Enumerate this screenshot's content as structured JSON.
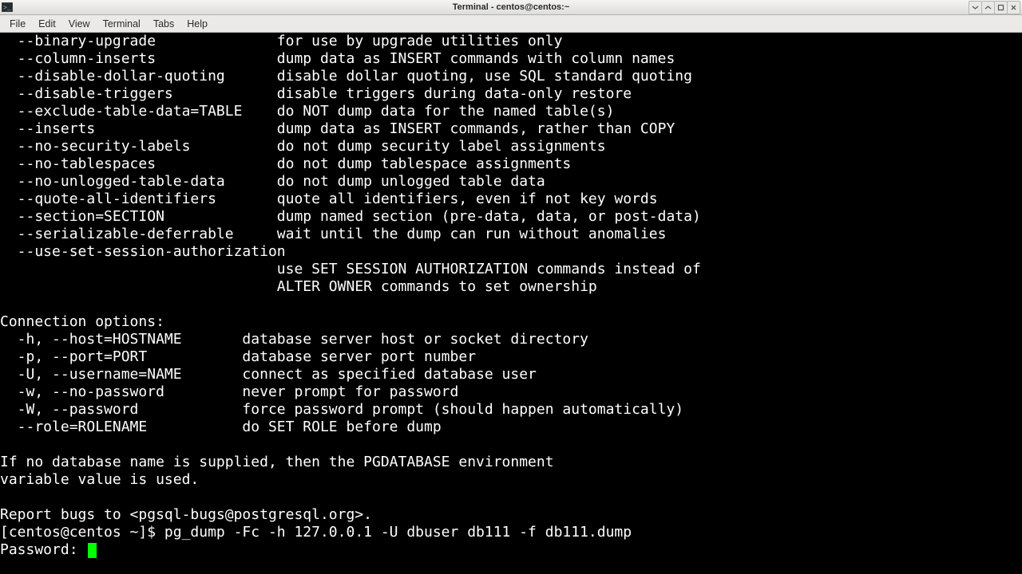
{
  "titlebar": {
    "title": "Terminal - centos@centos:~",
    "buttons": {
      "min": "▾",
      "max": "▴",
      "maxi": "▫",
      "close": "✕"
    }
  },
  "menubar": {
    "items": [
      "File",
      "Edit",
      "View",
      "Terminal",
      "Tabs",
      "Help"
    ]
  },
  "terminal": {
    "opts": [
      {
        "flag": "  --binary-upgrade",
        "desc": "for use by upgrade utilities only"
      },
      {
        "flag": "  --column-inserts",
        "desc": "dump data as INSERT commands with column names"
      },
      {
        "flag": "  --disable-dollar-quoting",
        "desc": "disable dollar quoting, use SQL standard quoting"
      },
      {
        "flag": "  --disable-triggers",
        "desc": "disable triggers during data-only restore"
      },
      {
        "flag": "  --exclude-table-data=TABLE",
        "desc": "do NOT dump data for the named table(s)"
      },
      {
        "flag": "  --inserts",
        "desc": "dump data as INSERT commands, rather than COPY"
      },
      {
        "flag": "  --no-security-labels",
        "desc": "do not dump security label assignments"
      },
      {
        "flag": "  --no-tablespaces",
        "desc": "do not dump tablespace assignments"
      },
      {
        "flag": "  --no-unlogged-table-data",
        "desc": "do not dump unlogged table data"
      },
      {
        "flag": "  --quote-all-identifiers",
        "desc": "quote all identifiers, even if not key words"
      },
      {
        "flag": "  --section=SECTION",
        "desc": "dump named section (pre-data, data, or post-data)"
      },
      {
        "flag": "  --serializable-deferrable",
        "desc": "wait until the dump can run without anomalies"
      }
    ],
    "auth_flag": "  --use-set-session-authorization",
    "auth_desc1": "                                   use SET SESSION AUTHORIZATION commands instead of",
    "auth_desc2": "                                   ALTER OWNER commands to set ownership",
    "blank": "",
    "conn_header": "Connection options:",
    "conn": [
      {
        "flag": "  -h, --host=HOSTNAME",
        "desc": "database server host or socket directory"
      },
      {
        "flag": "  -p, --port=PORT",
        "desc": "database server port number"
      },
      {
        "flag": "  -U, --username=NAME",
        "desc": "connect as specified database user"
      },
      {
        "flag": "  -w, --no-password",
        "desc": "never prompt for password"
      },
      {
        "flag": "  -W, --password",
        "desc": "force password prompt (should happen automatically)"
      },
      {
        "flag": "  --role=ROLENAME",
        "desc": "do SET ROLE before dump"
      }
    ],
    "note1": "If no database name is supplied, then the PGDATABASE environment",
    "note2": "variable value is used.",
    "report": "Report bugs to <pgsql-bugs@postgresql.org>.",
    "prompt_line": "[centos@centos ~]$ pg_dump -Fc -h 127.0.0.1 -U dbuser db111 -f db111.dump",
    "password_label": "Password: "
  }
}
